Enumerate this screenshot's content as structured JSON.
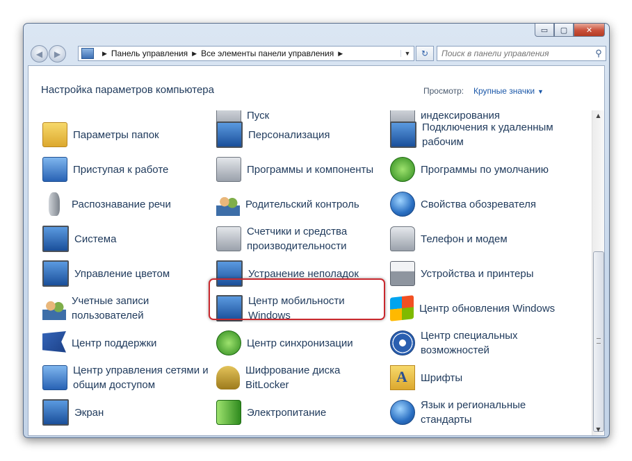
{
  "window": {
    "caption_buttons": {
      "minimize": "▭",
      "maximize": "▢",
      "close": "✕"
    }
  },
  "nav": {
    "back_icon": "back-arrow-icon",
    "forward_icon": "forward-arrow-icon",
    "breadcrumb": [
      "Панель управления",
      "Все элементы панели управления"
    ],
    "search_placeholder": "Поиск в панели управления"
  },
  "header": {
    "title": "Настройка параметров компьютера",
    "view_label": "Просмотр:",
    "view_value": "Крупные значки"
  },
  "items": [
    {
      "label": "Пуск",
      "icon": "taskbar-icon"
    },
    {
      "label": "индексирования",
      "icon": "indexing-icon"
    },
    {
      "label": "Параметры папок",
      "icon": "folder-options-icon"
    },
    {
      "label": "Персонализация",
      "icon": "personalization-icon"
    },
    {
      "label": "Подключения к удаленным рабочим",
      "icon": "remote-desktop-icon"
    },
    {
      "label": "Приступая к работе",
      "icon": "getting-started-icon"
    },
    {
      "label": "Программы и компоненты",
      "icon": "programs-features-icon"
    },
    {
      "label": "Программы по умолчанию",
      "icon": "default-programs-icon"
    },
    {
      "label": "Распознавание речи",
      "icon": "microphone-icon"
    },
    {
      "label": "Родительский контроль",
      "icon": "parental-controls-icon"
    },
    {
      "label": "Свойства обозревателя",
      "icon": "internet-options-icon"
    },
    {
      "label": "Система",
      "icon": "system-icon"
    },
    {
      "label": "Счетчики и средства производительности",
      "icon": "performance-icon"
    },
    {
      "label": "Телефон и модем",
      "icon": "phone-modem-icon"
    },
    {
      "label": "Управление цветом",
      "icon": "color-management-icon"
    },
    {
      "label": "Устранение неполадок",
      "icon": "troubleshooting-icon"
    },
    {
      "label": "Устройства и принтеры",
      "icon": "printer-icon"
    },
    {
      "label": "Учетные записи пользователей",
      "icon": "user-accounts-icon"
    },
    {
      "label": "Центр мобильности Windows",
      "icon": "mobility-center-icon"
    },
    {
      "label": "Центр обновления Windows",
      "icon": "windows-update-icon"
    },
    {
      "label": "Центр поддержки",
      "icon": "action-center-flag-icon"
    },
    {
      "label": "Центр синхронизации",
      "icon": "sync-center-icon"
    },
    {
      "label": "Центр специальных возможностей",
      "icon": "accessibility-icon"
    },
    {
      "label": "Центр управления сетями и общим доступом",
      "icon": "network-icon"
    },
    {
      "label": "Шифрование диска BitLocker",
      "icon": "bitlocker-key-icon"
    },
    {
      "label": "Шрифты",
      "icon": "fonts-icon"
    },
    {
      "label": "Экран",
      "icon": "display-icon"
    },
    {
      "label": "Электропитание",
      "icon": "power-options-icon"
    },
    {
      "label": "Язык и региональные стандарты",
      "icon": "region-language-icon"
    }
  ]
}
